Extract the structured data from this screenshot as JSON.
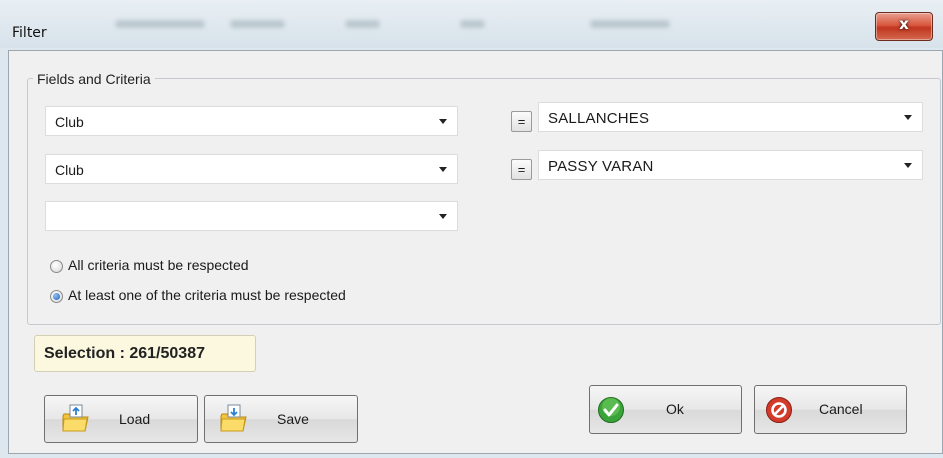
{
  "window": {
    "title": "Filter",
    "close_glyph": "x"
  },
  "group": {
    "legend": "Fields and Criteria"
  },
  "rows": [
    {
      "field": "Club",
      "operator": "=",
      "criterion": "SALLANCHES"
    },
    {
      "field": "Club",
      "operator": "=",
      "criterion": "PASSY VARAN"
    },
    {
      "field": ""
    }
  ],
  "options": {
    "all_label": "All criteria must be respected",
    "any_label": "At least one of the criteria must be respected",
    "selected": "any"
  },
  "selection": {
    "text": "Selection : 261/50387"
  },
  "buttons": {
    "load": "Load",
    "save": "Save",
    "ok": "Ok",
    "cancel": "Cancel"
  },
  "icons": {
    "load": "folder-load-icon",
    "save": "folder-save-icon",
    "ok": "checkmark-icon",
    "cancel": "prohibited-icon",
    "close": "close-icon"
  },
  "colors": {
    "ok_green": "#3aa33a",
    "cancel_red": "#d23a2a",
    "close_red": "#c8432b",
    "selection_bg": "#fbf8df",
    "radio_blue": "#1a5fb8"
  }
}
